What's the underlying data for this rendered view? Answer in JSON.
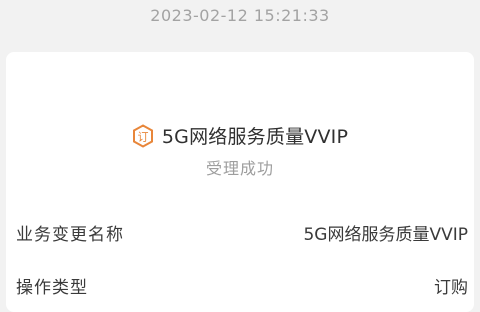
{
  "timestamp": "2023-02-12 15:21:33",
  "order": {
    "icon": "order-tag-icon",
    "accent_color": "#e8863a",
    "title": "5G网络服务质量VVIP",
    "status": "受理成功"
  },
  "details": [
    {
      "label": "业务变更名称",
      "value": "5G网络服务质量VVIP"
    },
    {
      "label": "操作类型",
      "value": "订购"
    }
  ]
}
